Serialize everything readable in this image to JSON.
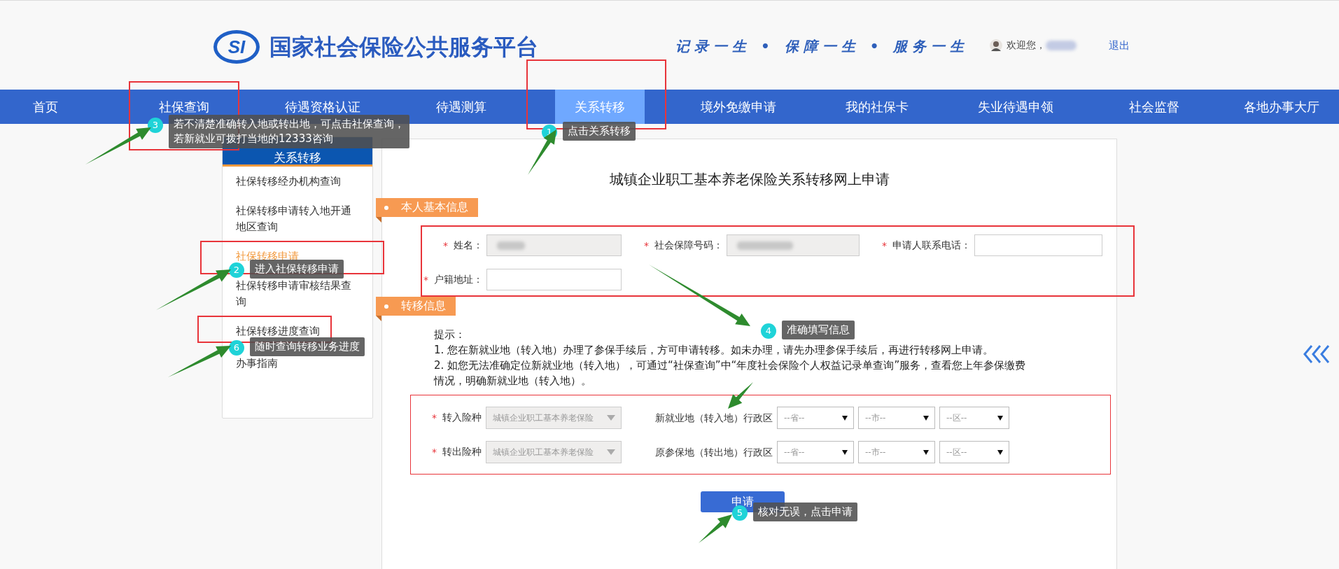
{
  "header": {
    "logo_mark": "SI",
    "site_title": "国家社会保险公共服务平台",
    "slogan": "记录一生 • 保障一生 • 服务一生",
    "welcome": "欢迎您，",
    "logout": "退出"
  },
  "nav": [
    {
      "label": "首页",
      "selected": false
    },
    {
      "label": "社保查询",
      "selected": false
    },
    {
      "label": "待遇资格认证",
      "selected": false
    },
    {
      "label": "待遇测算",
      "selected": false
    },
    {
      "label": "关系转移",
      "selected": true
    },
    {
      "label": "境外免缴申请",
      "selected": false
    },
    {
      "label": "我的社保卡",
      "selected": false
    },
    {
      "label": "失业待遇申领",
      "selected": false
    },
    {
      "label": "社会监督",
      "selected": false
    },
    {
      "label": "各地办事大厅",
      "selected": false
    }
  ],
  "sidebar": {
    "title": "关系转移",
    "items": [
      {
        "label": "社保转移经办机构查询",
        "selected": false
      },
      {
        "label": "社保转移申请转入地开通地区查询",
        "selected": false
      },
      {
        "label": "社保转移申请",
        "selected": true
      },
      {
        "label": "社保转移申请审核结果查询",
        "selected": false
      },
      {
        "label": "社保转移进度查询",
        "selected": false
      },
      {
        "label": "办事指南",
        "selected": false
      }
    ]
  },
  "form": {
    "title": "城镇企业职工基本养老保险关系转移网上申请",
    "personal": {
      "tag": "本人基本信息",
      "fields": [
        {
          "required_mark": "*",
          "label": "姓名：",
          "disabled": true,
          "redacted": true
        },
        {
          "required_mark": "*",
          "label": "社会保障号码：",
          "disabled": true,
          "redacted": true
        },
        {
          "required_mark": "*",
          "label": "申请人联系电话：",
          "disabled": false,
          "redacted": false
        },
        {
          "required_mark": "*",
          "label": "户籍地址：",
          "disabled": false,
          "redacted": false
        }
      ]
    },
    "transfer": {
      "tag": "转移信息",
      "tips": [
        "提示：",
        "1. 您在新就业地（转入地）办理了参保手续后，方可申请转移。如未办理，请先办理参保手续后，再进行转移网上申请。",
        "2. 如您无法准确定位新就业地（转入地），可通过“社保查询”中“年度社会保险个人权益记录单查询”服务，查看您上年参保缴费情况，明确新就业地（转入地）。"
      ],
      "rows": [
        {
          "required_mark": "*",
          "label": "转入险种",
          "insurance": {
            "value": "城镇企业职工基本养老保险",
            "disabled": true
          },
          "region_label": "新就业地（转入地）行政区",
          "region": [
            {
              "value": "--省--"
            },
            {
              "value": "--市--"
            },
            {
              "value": "--区--"
            }
          ]
        },
        {
          "required_mark": "*",
          "label": "转出险种",
          "insurance": {
            "value": "城镇企业职工基本养老保险",
            "disabled": true
          },
          "region_label": "原参保地（转出地）行政区",
          "region": [
            {
              "value": "--省--"
            },
            {
              "value": "--市--"
            },
            {
              "value": "--区--"
            }
          ]
        }
      ]
    },
    "submit": "申请"
  },
  "callouts": [
    {
      "number": "3",
      "lines": [
        "若不清楚准确转入地或转出地，可点击社保查询，",
        "若新就业可拨打当地的12333咨询"
      ]
    },
    {
      "number": "1",
      "lines": [
        "点击关系转移"
      ]
    },
    {
      "number": "2",
      "lines": [
        "进入社保转移申请"
      ]
    },
    {
      "number": "4",
      "lines": [
        "准确填写信息"
      ]
    },
    {
      "number": "6",
      "lines": [
        "随时查询转移业务进度"
      ]
    },
    {
      "number": "5",
      "lines": [
        "核对无误，点击申请"
      ]
    }
  ]
}
